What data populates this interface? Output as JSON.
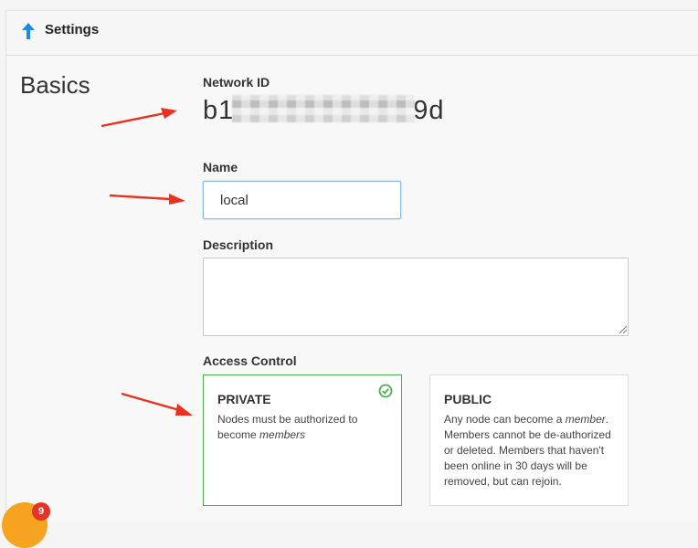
{
  "header": {
    "title": "Settings",
    "icon": "arrow-up-icon"
  },
  "section": {
    "title": "Basics"
  },
  "network_id": {
    "label": "Network ID",
    "prefix": "b1",
    "suffix": "9d"
  },
  "name": {
    "label": "Name",
    "value": "local"
  },
  "description": {
    "label": "Description",
    "value": ""
  },
  "access_control": {
    "label": "Access Control",
    "private": {
      "title": "PRIVATE",
      "desc_before": "Nodes must be authorized to become ",
      "desc_em": "members",
      "selected": true
    },
    "public": {
      "title": "PUBLIC",
      "desc_before": "Any node can become a ",
      "desc_em": "member",
      "desc_after": ". Members cannot be de-authorized or deleted. Members that haven't been online in 30 days will be removed, but can rejoin."
    }
  },
  "notification_badge": {
    "count": "9"
  },
  "colors": {
    "accent": "#1e88e5",
    "selected": "#4cae4c",
    "annotation_arrow": "#e8311f",
    "badge": "#e5332a"
  }
}
